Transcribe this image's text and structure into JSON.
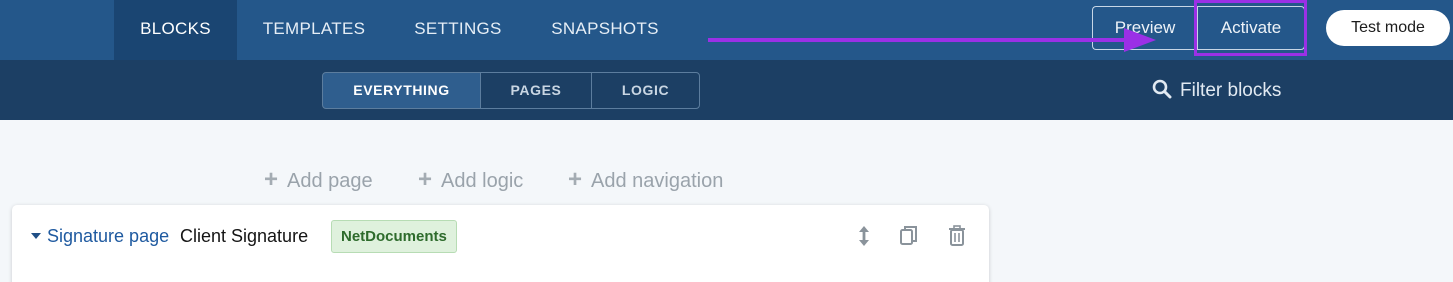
{
  "nav": {
    "tabs": [
      {
        "label": "BLOCKS",
        "active": true
      },
      {
        "label": "TEMPLATES"
      },
      {
        "label": "SETTINGS"
      },
      {
        "label": "SNAPSHOTS"
      }
    ],
    "preview_label": "Preview",
    "activate_label": "Activate",
    "test_mode_label": "Test mode"
  },
  "subnav": {
    "segments": [
      {
        "label": "EVERYTHING",
        "active": true
      },
      {
        "label": "PAGES"
      },
      {
        "label": "LOGIC"
      }
    ],
    "filter_label": "Filter blocks"
  },
  "actions": {
    "add_page": "Add page",
    "add_logic": "Add logic",
    "add_navigation": "Add navigation"
  },
  "block": {
    "type": "Signature page",
    "title": "Client Signature",
    "tag": "NetDocuments"
  },
  "colors": {
    "nav_bg": "#24578a",
    "nav_active": "#1a4572",
    "subnav_bg": "#1c3f64",
    "annotation": "#9b30e6",
    "tag_bg": "#dff1dd",
    "link": "#1f5aa0"
  },
  "icons": [
    "search-icon",
    "caret-down-icon",
    "move-vertical-icon",
    "copy-icon",
    "trash-icon",
    "plus-icon",
    "arrow-icon"
  ]
}
